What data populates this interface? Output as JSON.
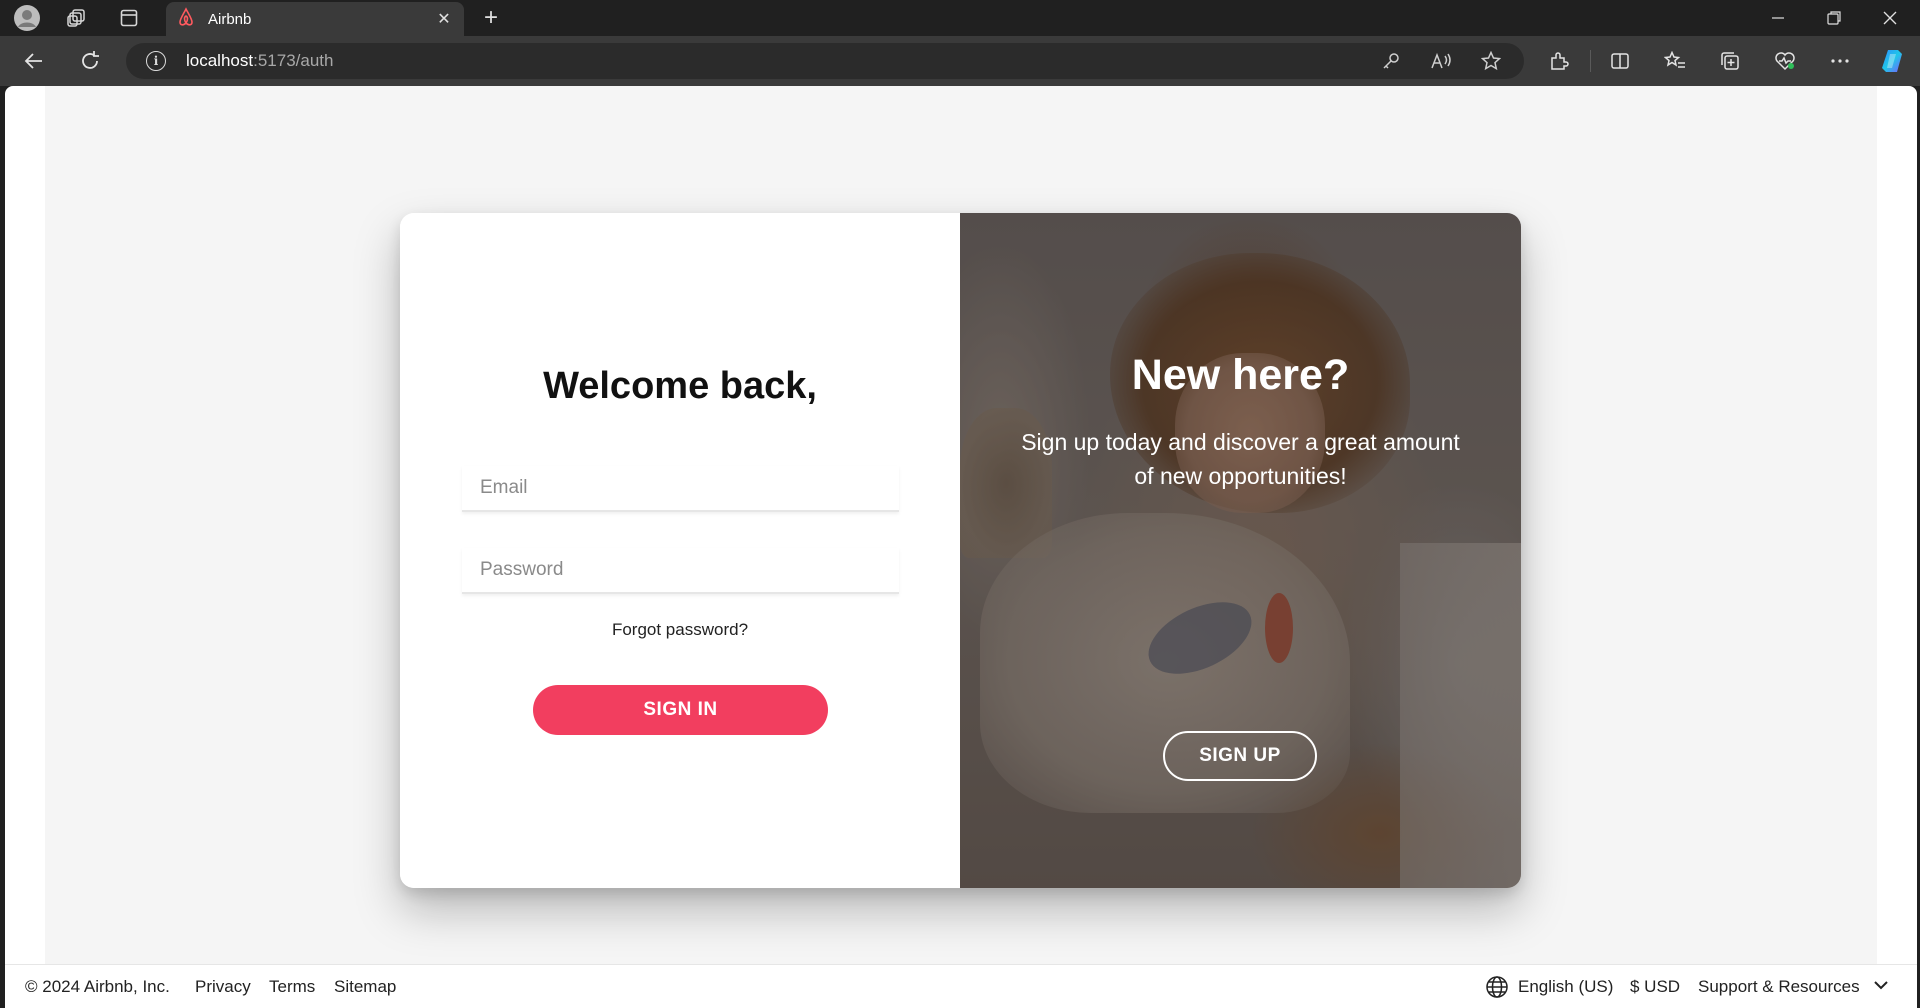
{
  "browser": {
    "tab_title": "Airbnb",
    "url_host": "localhost",
    "url_path": ":5173/auth",
    "new_tab_symbol": "+",
    "close_symbol": "✕"
  },
  "auth": {
    "welcome_title": "Welcome back,",
    "email_placeholder": "Email",
    "password_placeholder": "Password",
    "forgot_label": "Forgot password?",
    "signin_label": "SIGN IN",
    "new_here_title": "New here?",
    "new_here_sub": "Sign up today and discover a great amount of new opportunities!",
    "signup_label": "SIGN UP"
  },
  "footer": {
    "copyright": "© 2024 Airbnb, Inc.",
    "links": [
      "Privacy",
      "Terms",
      "Sitemap"
    ],
    "language": "English (US)",
    "currency": "$ USD",
    "support": "Support & Resources"
  },
  "colors": {
    "brand": "#f23e5f",
    "page_bg": "#f5f5f5",
    "chrome_dark": "#202020"
  }
}
